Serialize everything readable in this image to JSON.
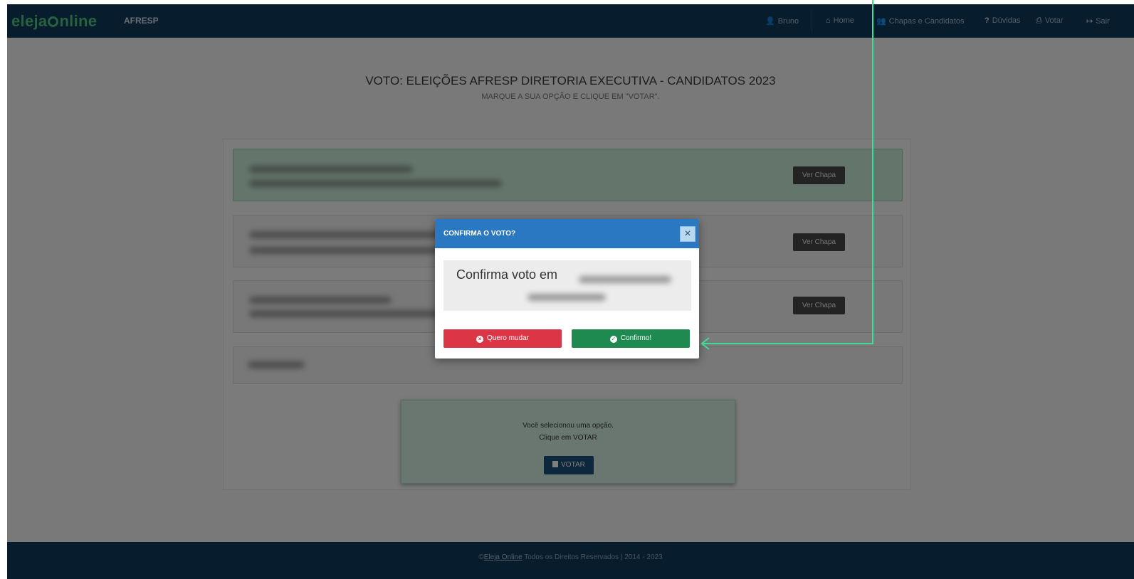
{
  "navbar": {
    "brand_prefix": "eleja",
    "brand_suffix": "nline",
    "brand_sub": "AFRESP",
    "items": [
      {
        "icon": "user-icon",
        "glyph": "👤",
        "label": "Bruno"
      },
      {
        "icon": "home-icon",
        "glyph": "⌂",
        "label": "Home"
      },
      {
        "icon": "users-icon",
        "glyph": "👥",
        "label": "Chapas e Candidatos"
      },
      {
        "icon": "question-icon",
        "glyph": "?",
        "label": "Dúvidas"
      },
      {
        "icon": "print-icon",
        "glyph": "⎙",
        "label": "Votar"
      },
      {
        "icon": "logout-icon",
        "glyph": "↦",
        "label": "Sair"
      }
    ]
  },
  "page": {
    "title": "VOTO: ELEIÇÕES AFRESP DIRETORIA EXECUTIVA - CANDIDATOS 2023",
    "subtitle": "MARQUE A SUA OPÇÃO E CLIQUE EM \"VOTAR\"."
  },
  "options": [
    {
      "button": "Ver Chapa",
      "selected": true
    },
    {
      "button": "Ver Chapa",
      "selected": false
    },
    {
      "button": "Ver Chapa",
      "selected": false
    },
    {
      "button": "",
      "selected": false
    }
  ],
  "info": {
    "line1": "Você selecionou uma opção.",
    "line2": "Clique em VOTAR",
    "votar_label": "VOTAR",
    "votar_icon": "ballot-icon"
  },
  "modal": {
    "title": "CONFIRMA O VOTO?",
    "close_glyph": "×",
    "confirm_text": "Confirma voto em",
    "cancel_label": "Quero mudar",
    "cancel_icon": "times-circle-icon",
    "confirm_label": "Confirmo!",
    "confirm_icon": "check-circle-icon"
  },
  "footer": {
    "copyright": "©",
    "link": "Eleja Online",
    "rest": " Todos os Direitos Reservados  |  2014 - 2023"
  },
  "colors": {
    "navbar": "#0e3a5c",
    "brand": "#4fc37a",
    "modal_header": "#2b78c2",
    "cancel": "#dc3545",
    "confirm": "#1e8a50",
    "arrow": "#3ddc97"
  }
}
